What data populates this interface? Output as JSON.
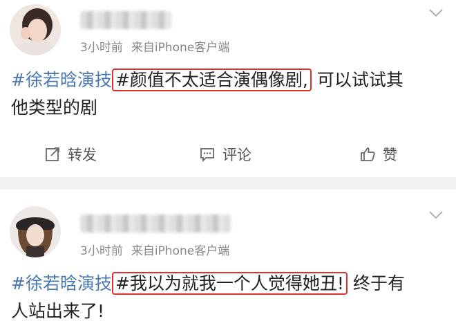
{
  "posts": [
    {
      "time": "3小时前",
      "source": "来自iPhone客户端",
      "topic": "#徐若晗演技",
      "highlight": "#颜值不太适合演偶像剧,",
      "rest_line1": "可以试试其",
      "rest_line2": "他类型的剧",
      "actions": {
        "repost": "转发",
        "comment": "评论",
        "like": "赞"
      }
    },
    {
      "time": "3小时前",
      "source": "来自iPhone客户端",
      "topic": "#徐若晗演技",
      "highlight": "#我以为就我一个人觉得她丑!",
      "rest_line1": "终于有",
      "rest_line2": "人站出来了!"
    }
  ],
  "colors": {
    "topic": "#4a78b7",
    "highlight_border": "#e0322b",
    "meta": "#888888"
  }
}
